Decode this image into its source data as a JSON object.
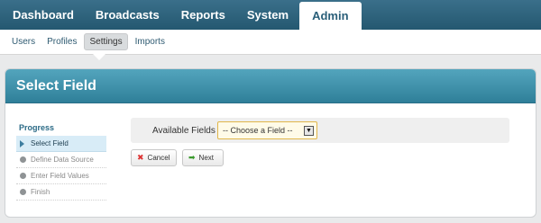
{
  "topnav": {
    "tabs": [
      "Dashboard",
      "Broadcasts",
      "Reports",
      "System",
      "Admin"
    ],
    "active": "Admin"
  },
  "subnav": {
    "items": [
      "Users",
      "Profiles",
      "Settings",
      "Imports"
    ],
    "active": "Settings"
  },
  "panel": {
    "title": "Select Field"
  },
  "progress": {
    "title": "Progress",
    "steps": [
      {
        "label": "Select Field",
        "state": "current",
        "icon": "arrow-right-icon"
      },
      {
        "label": "Define Data Source",
        "state": "pending",
        "icon": "bullet-icon"
      },
      {
        "label": "Enter Field Values",
        "state": "pending",
        "icon": "bullet-icon"
      },
      {
        "label": "Finish",
        "state": "pending",
        "icon": "bullet-icon"
      }
    ]
  },
  "form": {
    "available_fields_label": "Available Fields",
    "select_value": "-- Choose a Field --"
  },
  "buttons": {
    "cancel_label": "Cancel",
    "next_label": "Next"
  },
  "colors": {
    "nav": "#2f6680",
    "header": "#3d94b0",
    "accent": "#e0b64b"
  }
}
